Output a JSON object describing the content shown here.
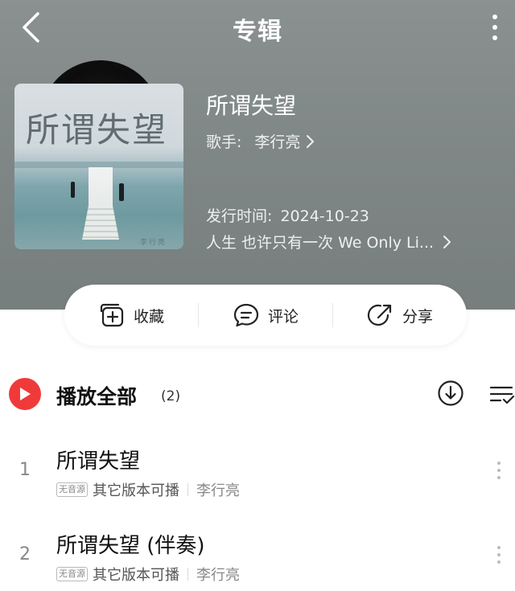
{
  "header": {
    "title": "专辑"
  },
  "album": {
    "cover_title": "所谓失望",
    "name": "所谓失望",
    "artist_label": "歌手:",
    "artist_name": "李行亮",
    "release_label": "发行时间:",
    "release_date": "2024-10-23",
    "description": "人生 也许只有一次 We Only Li...",
    "cover_signature": "李行亮"
  },
  "actions": {
    "collect": "收藏",
    "comment": "评论",
    "share": "分享"
  },
  "play_all": {
    "label": "播放全部",
    "count": "(2)"
  },
  "tracks": [
    {
      "number": "1",
      "title": "所谓失望",
      "badge": "无音源",
      "availability": "其它版本可播",
      "artist": "李行亮"
    },
    {
      "number": "2",
      "title": "所谓失望 (伴奏)",
      "badge": "无音源",
      "availability": "其它版本可播",
      "artist": "李行亮"
    }
  ],
  "colors": {
    "accent": "#f03a3a",
    "header_bg": "#828989",
    "icon": "#222222"
  },
  "icons": {
    "back": "chevron-left-icon",
    "more": "more-vertical-icon",
    "collect": "add-box-icon",
    "comment": "comment-icon",
    "share": "share-icon",
    "play": "play-icon",
    "download": "download-icon",
    "multiselect": "list-check-icon"
  }
}
